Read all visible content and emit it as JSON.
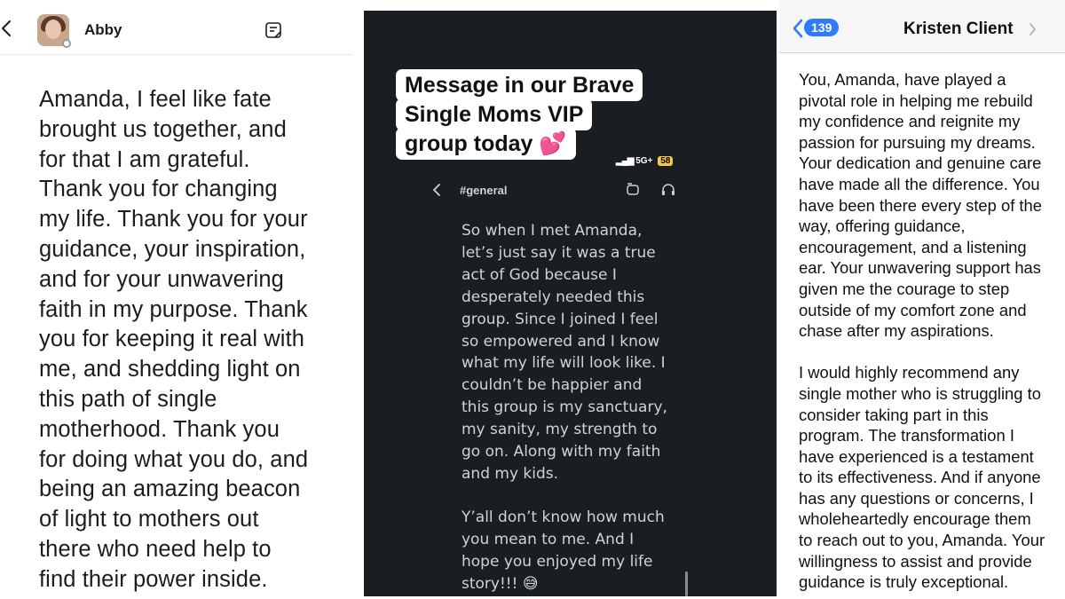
{
  "panel1": {
    "contact_name": "Abby",
    "lines": [
      "Amanda, I feel like fate",
      "brought us together, and",
      "for that I am grateful.",
      "Thank you for changing",
      "my life. Thank you for your",
      "guidance, your inspiration,",
      "and for your unwavering",
      "faith in my purpose. Thank",
      "you for keeping it real with",
      "me, and shedding light on",
      "this path of single",
      "motherhood. Thank you",
      "for doing what you do, and",
      "being an amazing beacon",
      "of light to mothers out",
      "there who need help to",
      "find their power inside."
    ],
    "icons": [
      "chevron-left-icon",
      "avatar",
      "note-icon"
    ]
  },
  "panel2": {
    "caption": [
      "Message in our Brave",
      "Single Moms VIP",
      "group today 💕"
    ],
    "status": {
      "signal": "5G+",
      "battery": "58"
    },
    "channel": "#general",
    "paragraph1": [
      "So when I met Amanda,",
      "let’s just say it was a true",
      "act of God because I",
      "desperately needed this",
      "group. Since I joined I feel",
      "so empowered and I know",
      "what my life will look like. I",
      "couldn’t be happier and",
      "this group is my sanctuary,",
      "my sanity, my strength to",
      "go on. Along with my faith",
      "and my kids."
    ],
    "paragraph2": [
      "Y’all don’t know how much",
      "you mean to me. And I",
      "hope you enjoyed my life",
      "story!!! 😅"
    ],
    "icons": [
      "chevron-left-icon",
      "thread-icon",
      "headphones-icon"
    ],
    "colors": {
      "background": "#1a1d21",
      "text": "#d1d2d3"
    }
  },
  "panel3": {
    "unread_count": "139",
    "contact_name": "Kristen Client",
    "paragraph1": [
      "You, Amanda, have played a",
      "pivotal role in helping me rebuild",
      "my confidence and reignite my",
      "passion for pursuing my dreams.",
      "Your dedication and genuine care",
      "have made all the difference. You",
      "have been there every step of the",
      "way, offering guidance,",
      "encouragement, and a listening",
      "ear. Your unwavering support has",
      "given me the courage to step",
      "outside of my comfort zone and",
      "chase after my aspirations."
    ],
    "paragraph2": [
      "I would highly recommend any",
      "single mother who is struggling to",
      "consider taking part in this",
      "program. The transformation I",
      "have experienced is a testament",
      "to its effectiveness. And if anyone",
      "has any questions or concerns, I",
      "wholeheartedly encourage them",
      "to reach out to you, Amanda. Your",
      "willingness to assist and provide",
      "guidance is truly exceptional."
    ],
    "colors": {
      "accent": "#2f7cf6"
    }
  }
}
